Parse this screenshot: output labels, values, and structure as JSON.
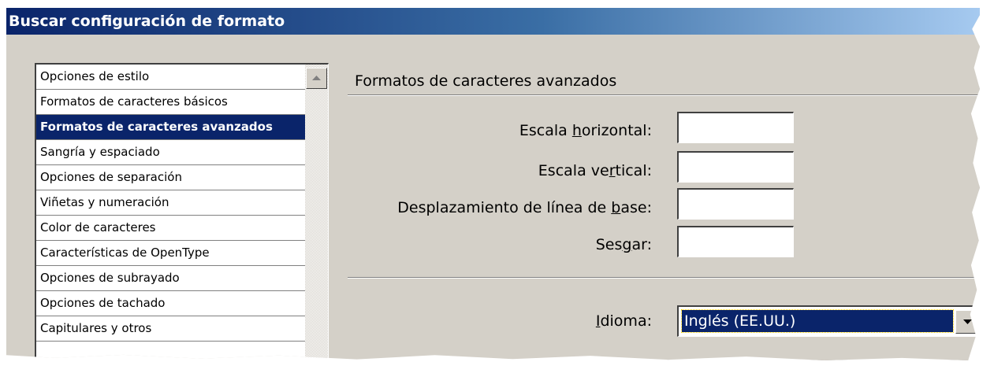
{
  "window": {
    "title": "Buscar configuración de formato"
  },
  "sidebar": {
    "items": [
      {
        "label": "Opciones de estilo",
        "selected": false
      },
      {
        "label": "Formatos de caracteres básicos",
        "selected": false
      },
      {
        "label": "Formatos de caracteres avanzados",
        "selected": true
      },
      {
        "label": "Sangría y espaciado",
        "selected": false
      },
      {
        "label": "Opciones de separación",
        "selected": false
      },
      {
        "label": "Viñetas y numeración",
        "selected": false
      },
      {
        "label": "Color de caracteres",
        "selected": false
      },
      {
        "label": "Características de OpenType",
        "selected": false
      },
      {
        "label": "Opciones de subrayado",
        "selected": false
      },
      {
        "label": "Opciones de tachado",
        "selected": false
      },
      {
        "label": "Capitulares y otros",
        "selected": false
      }
    ],
    "scroll_up_icon": "triangle-up-icon"
  },
  "main": {
    "section_title": "Formatos de caracteres avanzados",
    "fields": {
      "horizontal_scale": {
        "label_before": "Escala ",
        "label_mnemonic": "h",
        "label_after": "orizontal:",
        "value": ""
      },
      "vertical_scale": {
        "label_before": "Escala ve",
        "label_mnemonic": "r",
        "label_after": "tical:",
        "value": ""
      },
      "baseline_shift": {
        "label_before": "Desplazamiento de línea de ",
        "label_mnemonic": "b",
        "label_after": "ase:",
        "value": ""
      },
      "skew": {
        "label_before": "Ses",
        "label_mnemonic": "g",
        "label_after": "ar:",
        "value": ""
      }
    },
    "language": {
      "label_before": "",
      "label_mnemonic": "I",
      "label_after": "dioma:",
      "selected": "Inglés (EE.UU.)",
      "dropdown_icon": "triangle-down-icon"
    }
  },
  "colors": {
    "title_gradient_start": "#0a246a",
    "title_gradient_end": "#a6caf0",
    "selection": "#0a246a",
    "dialog_face": "#d4d0c8"
  }
}
